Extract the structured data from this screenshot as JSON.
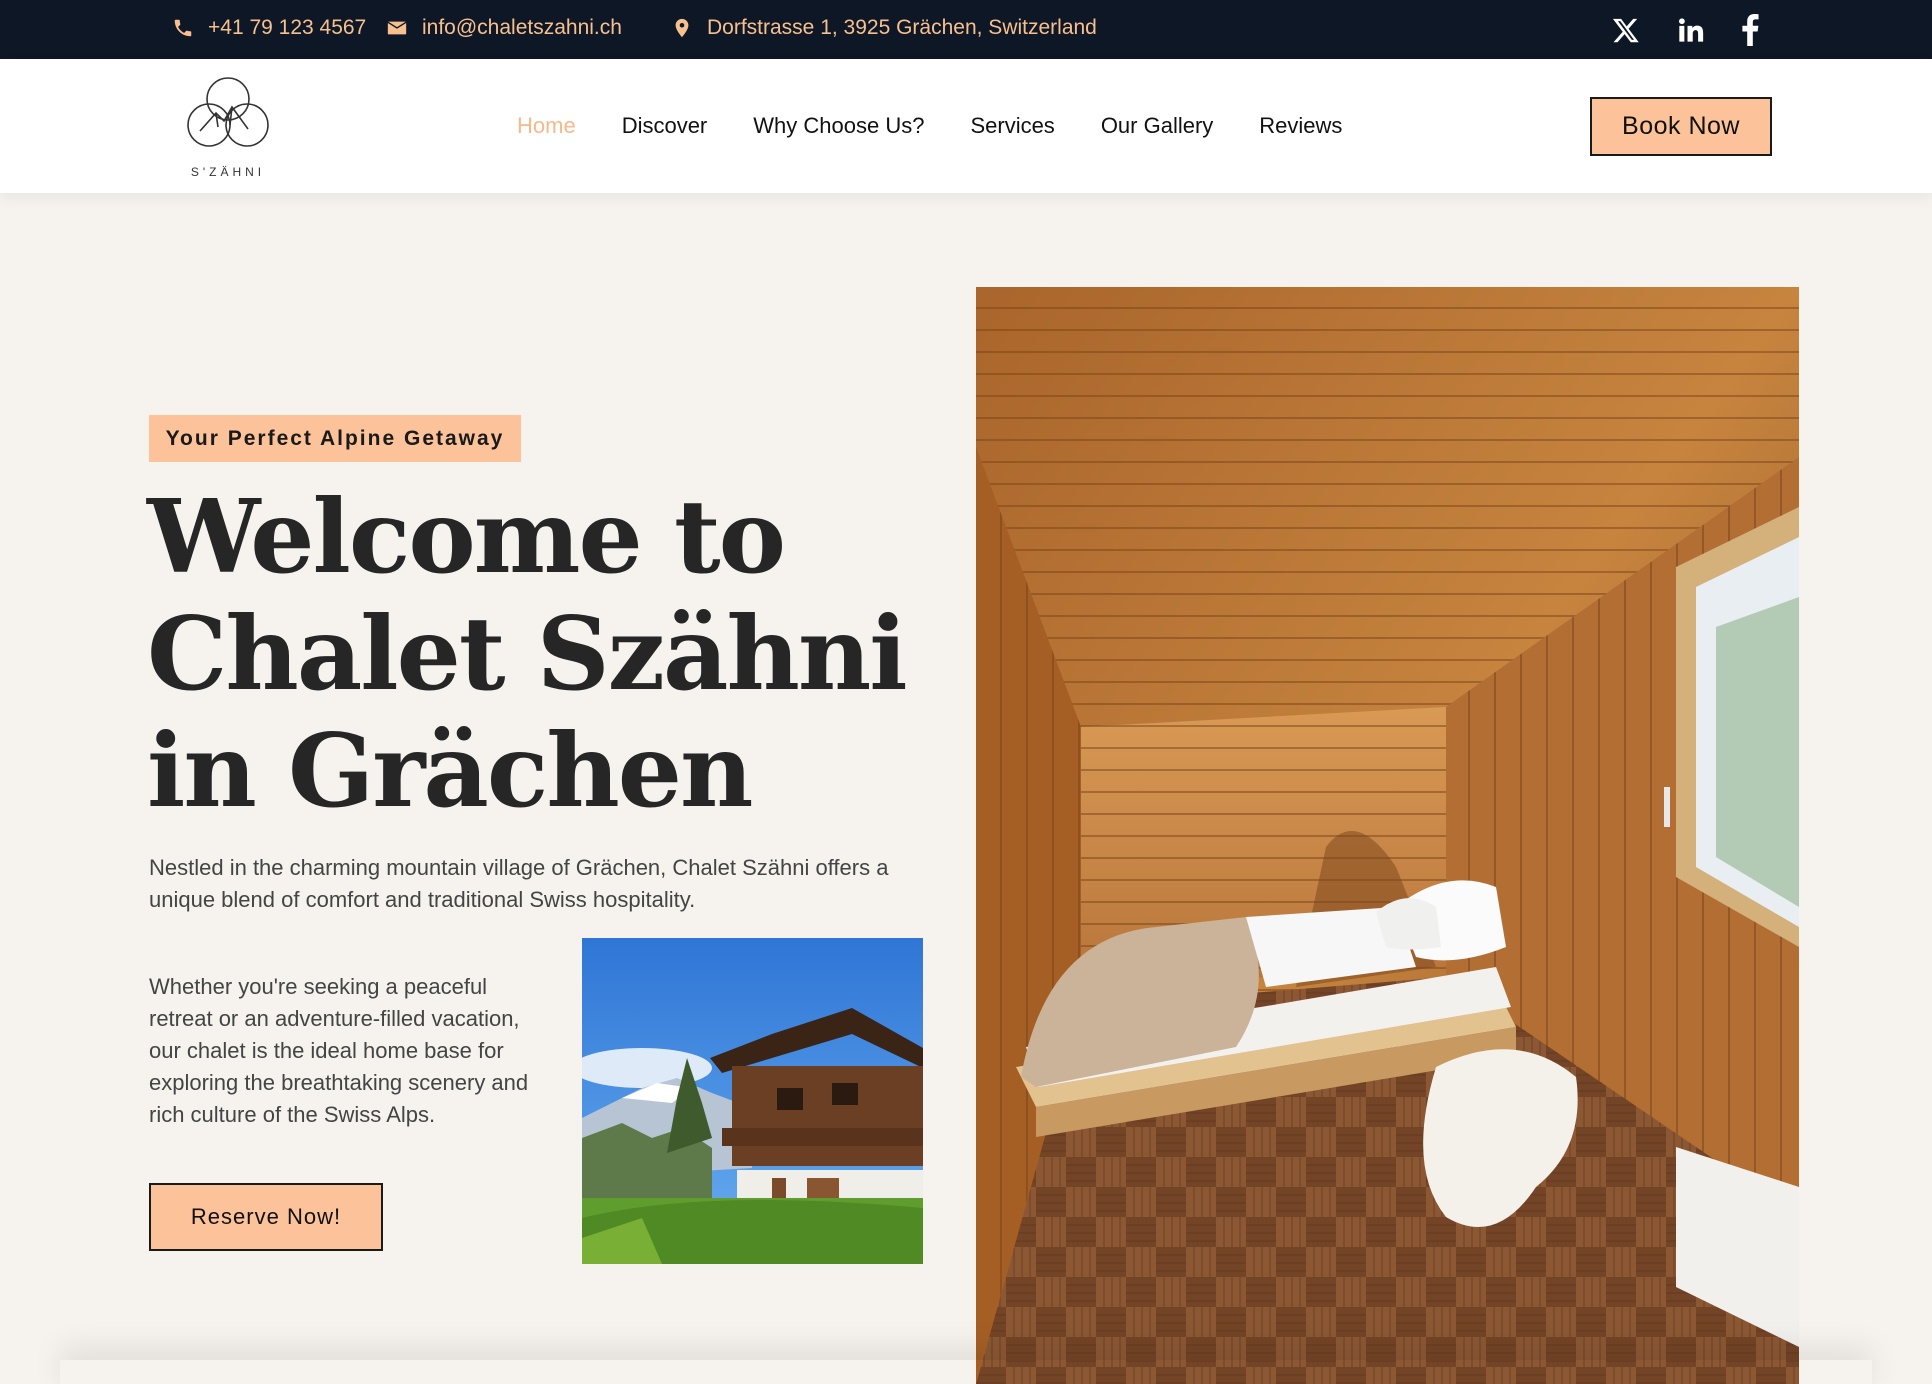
{
  "topbar": {
    "phone": "+41 79 123 4567",
    "email": "info@chaletszahni.ch",
    "address": "Dorfstrasse 1, 3925 Grächen, Switzerland",
    "icons": [
      "phone-icon",
      "envelope-icon",
      "map-pin-icon"
    ],
    "social": [
      "x-icon",
      "linkedin-icon",
      "facebook-icon"
    ]
  },
  "brand": {
    "logo_text": "S'ZÄHNI"
  },
  "nav": {
    "items": [
      {
        "label": "Home",
        "active": true
      },
      {
        "label": "Discover",
        "active": false
      },
      {
        "label": "Why Choose Us?",
        "active": false
      },
      {
        "label": "Services",
        "active": false
      },
      {
        "label": "Our Gallery",
        "active": false
      },
      {
        "label": "Reviews",
        "active": false
      }
    ],
    "cta": "Book Now"
  },
  "hero": {
    "tagline": "Your Perfect Alpine Getaway",
    "title_lines": [
      "Welcome to",
      "Chalet Szähni",
      "in Grächen"
    ],
    "description": "Nestled in the charming mountain village of Grächen, Chalet Szähni offers a unique blend of comfort and traditional Swiss hospitality.",
    "description2": "Whether you're seeking a peaceful retreat or an adventure-filled vacation, our chalet is the ideal home base for exploring the breathtaking scenery and rich culture of the Swiss Alps.",
    "cta": "Reserve Now!"
  },
  "colors": {
    "accent": "#fcc39a",
    "accent_text": "#f7b98a",
    "topbar_bg": "#0e1726",
    "page_bg": "#f6f3ee"
  }
}
